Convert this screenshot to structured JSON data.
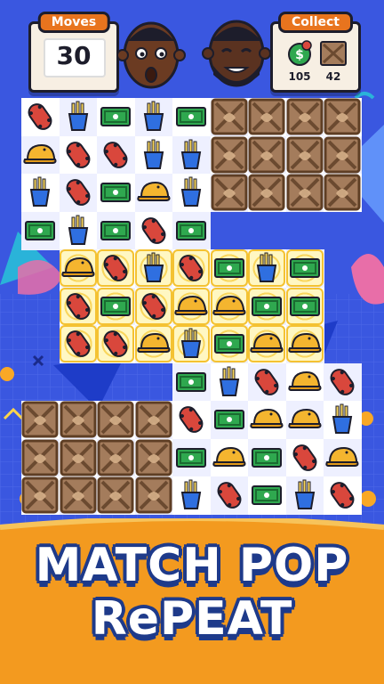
{
  "hud": {
    "moves_label": "Moves",
    "moves_value": "30",
    "collect_label": "Collect",
    "collect_money_count": "105",
    "collect_crate_count": "42"
  },
  "slogan": {
    "line1": "MATCH POP",
    "line2": "RePEAT"
  },
  "board": {
    "cols": 9,
    "rows": 11,
    "active_rows": [
      [
        0,
        0,
        0,
        0,
        0,
        0,
        0,
        0,
        0
      ],
      [
        0,
        0,
        0,
        0,
        0,
        0,
        0,
        0,
        0
      ],
      [
        0,
        0,
        0,
        0,
        0,
        0,
        0,
        0,
        0
      ],
      [
        0,
        0,
        0,
        0,
        0,
        0,
        0,
        0,
        0
      ],
      [
        0,
        0,
        0,
        0,
        0,
        0,
        0,
        0,
        0
      ],
      [
        0,
        0,
        0,
        0,
        0,
        0,
        0,
        0,
        0
      ],
      [
        0,
        0,
        0,
        0,
        0,
        0,
        0,
        0,
        0
      ],
      [
        0,
        0,
        0,
        0,
        0,
        0,
        0,
        0,
        0
      ],
      [
        0,
        0,
        0,
        0,
        0,
        0,
        0,
        0,
        0
      ],
      [
        0,
        0,
        0,
        0,
        0,
        0,
        0,
        0,
        0
      ],
      [
        0,
        0,
        0,
        0,
        0,
        0,
        0,
        0,
        0
      ]
    ],
    "tiles": [
      [
        "skate",
        "fries",
        "cash",
        "fries",
        "cash",
        "crate",
        "crate",
        "crate",
        "crate"
      ],
      [
        "cap",
        "skate",
        "skate",
        "fries",
        "fries",
        "crate",
        "crate",
        "crate",
        "crate"
      ],
      [
        "fries",
        "skate",
        "cash",
        "cap",
        "fries",
        "crate",
        "crate",
        "crate",
        "crate"
      ],
      [
        "cash",
        "fries",
        "cash",
        "skate",
        "cash",
        "",
        "",
        "",
        ""
      ],
      [
        "",
        "cap*",
        "skate*",
        "fries*",
        "skate*",
        "cash*",
        "fries*",
        "cash*",
        ""
      ],
      [
        "",
        "skate*",
        "cash*",
        "skate*",
        "cap*",
        "cap*",
        "cash*",
        "cash*",
        ""
      ],
      [
        "",
        "skate*",
        "skate*",
        "cap*",
        "fries*",
        "cash*",
        "cap*",
        "cap*",
        ""
      ],
      [
        "",
        "",
        "",
        "",
        "cash",
        "fries",
        "skate",
        "cap",
        "skate"
      ],
      [
        "crate",
        "crate",
        "crate",
        "crate",
        "skate",
        "cash",
        "cap",
        "cap",
        "fries"
      ],
      [
        "crate",
        "crate",
        "crate",
        "crate",
        "cash",
        "cap",
        "cash",
        "skate",
        "cap"
      ],
      [
        "crate",
        "crate",
        "crate",
        "crate",
        "fries",
        "skate",
        "cash",
        "fries",
        "skate"
      ]
    ]
  },
  "colors": {
    "sky": "#3a57e0",
    "board_light": "#ffffff",
    "board_dark": "#eef0ff",
    "crate": "#a47c5c",
    "banner": "#f39a1f",
    "accent": "#e8741e"
  }
}
